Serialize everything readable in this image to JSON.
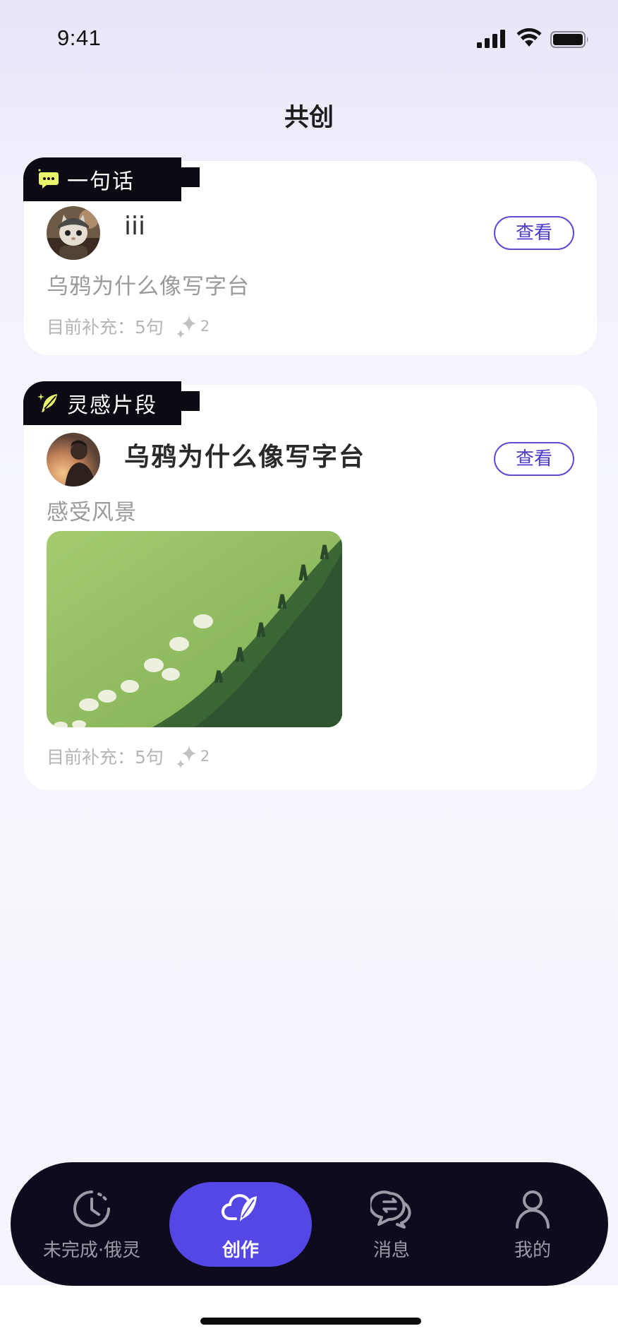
{
  "status_bar": {
    "time": "9:41"
  },
  "page": {
    "title": "共创"
  },
  "cards": [
    {
      "tag": "一句话",
      "tag_icon": "chat-bubble-icon",
      "name": "iii",
      "content": "乌鸦为什么像写字台",
      "view_label": "查看",
      "meta_text": "目前补充：5句",
      "sparkle_count": "2"
    },
    {
      "tag": "灵感片段",
      "tag_icon": "feather-icon",
      "name": "乌鸦为什么像写字台",
      "content": "感受风景",
      "view_label": "查看",
      "meta_text": "目前补充：5句",
      "sparkle_count": "2",
      "image": "sheep-on-green-hillside-image"
    }
  ],
  "bottom_nav": [
    {
      "label": "未完成·俄灵",
      "icon": "clock-history-icon"
    },
    {
      "label": "创作",
      "icon": "cloud-feather-icon",
      "active": true
    },
    {
      "label": "消息",
      "icon": "chat-arrows-icon"
    },
    {
      "label": "我的",
      "icon": "person-icon"
    }
  ],
  "colors": {
    "accent": "#5547e6",
    "nav_background": "#0e0b1e",
    "tag_background": "#0e0a14",
    "tag_icon_yellow": "#e9f56a"
  }
}
